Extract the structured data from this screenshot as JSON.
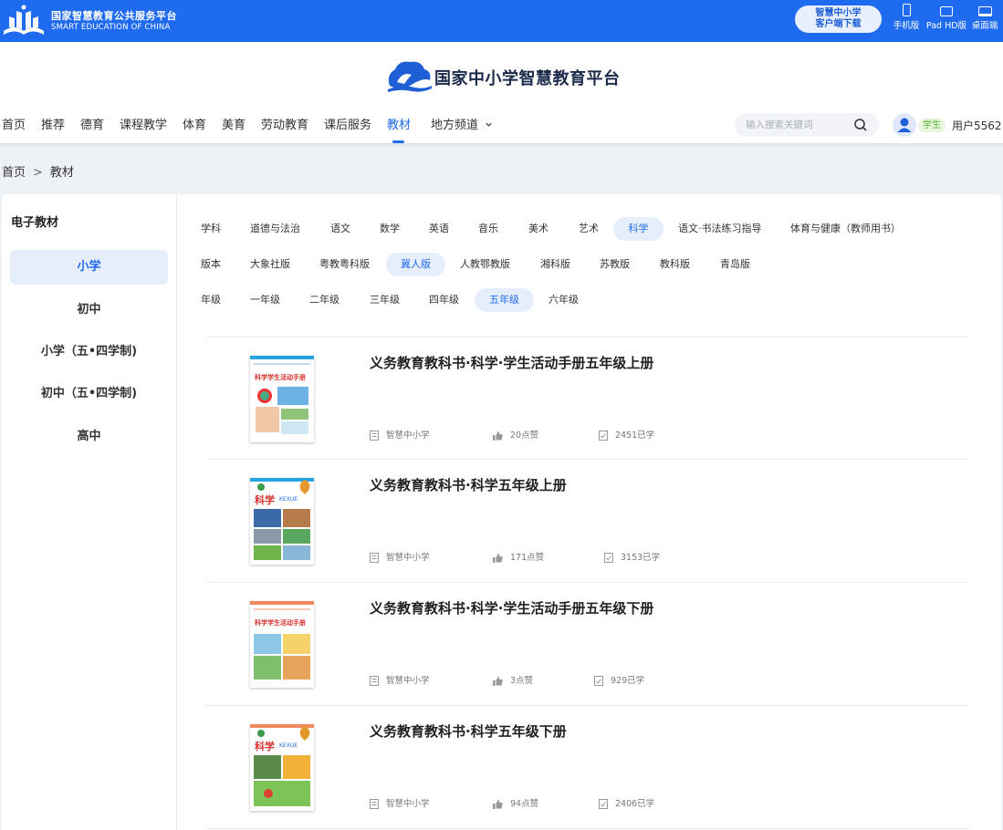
{
  "topbar": {
    "logo_cn": "国家智慧教育公共服务平台",
    "logo_en": "SMART EDUCATION OF CHINA",
    "download_line1": "智慧中小学",
    "download_line2": "客户端下载",
    "devices": [
      {
        "label": "手机版",
        "icon": "phone-icon"
      },
      {
        "label": "Pad HD版",
        "icon": "tablet-icon"
      },
      {
        "label": "桌面端",
        "icon": "desktop-icon"
      }
    ]
  },
  "header": {
    "brand_title": "国家中小学智慧教育平台"
  },
  "nav": {
    "items": [
      "首页",
      "推荐",
      "德育",
      "课程教学",
      "体育",
      "美育",
      "劳动教育",
      "课后服务",
      "教材",
      "地方频道"
    ],
    "active": "教材"
  },
  "search": {
    "placeholder": "输入搜索关键词"
  },
  "user": {
    "role": "学生",
    "name": "用户5562"
  },
  "breadcrumb": {
    "home": "首页",
    "sep": ">",
    "current": "教材"
  },
  "sidebar": {
    "title": "电子教材",
    "items": [
      "小学",
      "初中",
      "小学（五•四学制)",
      "初中（五•四学制)",
      "高中"
    ],
    "active": "小学"
  },
  "filters": {
    "subject": {
      "label": "学科",
      "options": [
        "道德与法治",
        "语文",
        "数学",
        "英语",
        "音乐",
        "美术",
        "艺术",
        "科学",
        "语文·书法练习指导",
        "体育与健康（教师用书）"
      ],
      "selected": "科学"
    },
    "edition": {
      "label": "版本",
      "options": [
        "大象社版",
        "粤教粤科版",
        "冀人版",
        "人教鄂教版",
        "湘科版",
        "苏教版",
        "教科版",
        "青岛版"
      ],
      "selected": "冀人版"
    },
    "grade": {
      "label": "年级",
      "options": [
        "一年级",
        "二年级",
        "三年级",
        "四年级",
        "五年级",
        "六年级"
      ],
      "selected": "五年级"
    }
  },
  "books": [
    {
      "title": "义务教育教科书·科学·学生活动手册五年级上册",
      "publisher": "智慧中小学",
      "likes": "20点赞",
      "studies": "2451已学"
    },
    {
      "title": "义务教育教科书·科学五年级上册",
      "publisher": "智慧中小学",
      "likes": "171点赞",
      "studies": "3153已学"
    },
    {
      "title": "义务教育教科书·科学·学生活动手册五年级下册",
      "publisher": "智慧中小学",
      "likes": "3点赞",
      "studies": "929已学"
    },
    {
      "title": "义务教育教科书·科学五年级下册",
      "publisher": "智慧中小学",
      "likes": "94点赞",
      "studies": "2406已学"
    }
  ],
  "cover_text": {
    "handbook": "科学学生活动手册",
    "science": "科学",
    "science_en": "KEXUE"
  },
  "colors": {
    "primary": "#1f6bef",
    "topbar": "#1f6bef",
    "selected_bg": "#e6eefc",
    "page_bg": "#eef1f6"
  }
}
